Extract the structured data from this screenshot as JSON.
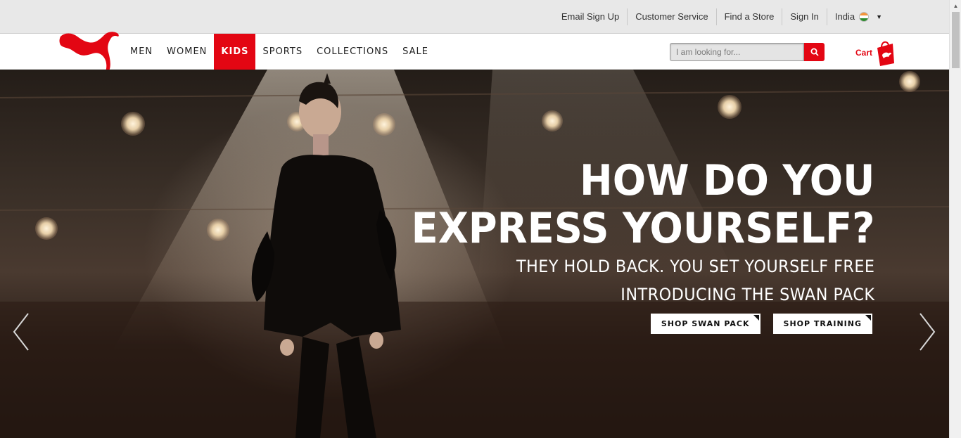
{
  "utility_bar": {
    "links": [
      "Email Sign Up",
      "Customer Service",
      "Find a Store",
      "Sign In"
    ],
    "country": "India"
  },
  "nav": {
    "items": [
      "MEN",
      "WOMEN",
      "KIDS",
      "SPORTS",
      "COLLECTIONS",
      "SALE"
    ],
    "active": "KIDS"
  },
  "search": {
    "placeholder": "I am looking for..."
  },
  "cart": {
    "label": "Cart"
  },
  "hero": {
    "headline_line1": "HOW DO YOU",
    "headline_line2": "EXPRESS YOURSELF?",
    "sub_line1": "THEY HOLD BACK. YOU SET YOURSELF FREE",
    "sub_line2": "INTRODUCING THE SWAN PACK",
    "cta_primary": "SHOP SWAN PACK",
    "cta_secondary": "SHOP TRAINING"
  },
  "colors": {
    "brand_red": "#e30613",
    "utility_bg": "#e8e8e8"
  }
}
